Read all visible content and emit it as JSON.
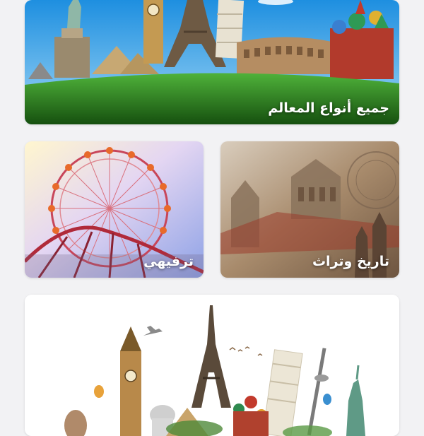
{
  "categories": {
    "all": {
      "label": "جميع أنواع المعالم"
    },
    "entertainment": {
      "label": "ترفيهي"
    },
    "history": {
      "label": "تاريخ وتراث"
    }
  },
  "colors": {
    "page_background": "#f2f2f4",
    "label_text": "#ffffff",
    "grass": "#2f8a22",
    "sky": "#3aa6e6"
  }
}
